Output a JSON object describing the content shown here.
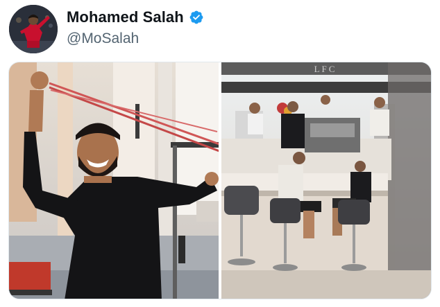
{
  "tweet": {
    "author": {
      "display_name": "Mohamed Salah",
      "handle": "@MoSalah",
      "verified": true,
      "avatar_icon": "profile-photo"
    },
    "media": [
      {
        "kind": "photo",
        "icon": "gym-resistance-band-photo"
      },
      {
        "kind": "photo",
        "icon": "cafe-players-photo",
        "sign_text": "LFC"
      }
    ],
    "colors": {
      "verified_blue": "#1d9bf0",
      "name_text": "#0f1419",
      "handle_text": "#536471"
    }
  }
}
